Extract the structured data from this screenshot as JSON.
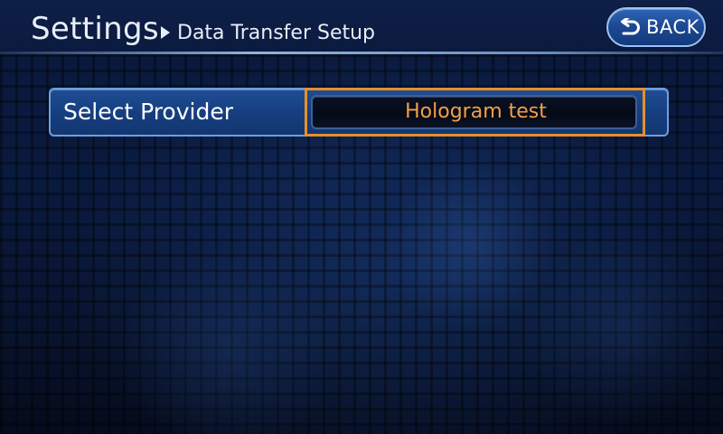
{
  "header": {
    "title": "Settings",
    "breadcrumb": "Data Transfer Setup",
    "back_label": "BACK"
  },
  "icons": {
    "breadcrumb_separator": "triangle-right-icon",
    "back": "return-arrow-icon"
  },
  "setting": {
    "label": "Select Provider",
    "value": "Hologram test"
  },
  "colors": {
    "background": "#0a1838",
    "accent_focus": "#e6902a",
    "value_text": "#f2a048",
    "button_blue": "#1d4a94",
    "text": "#e8eef8"
  }
}
